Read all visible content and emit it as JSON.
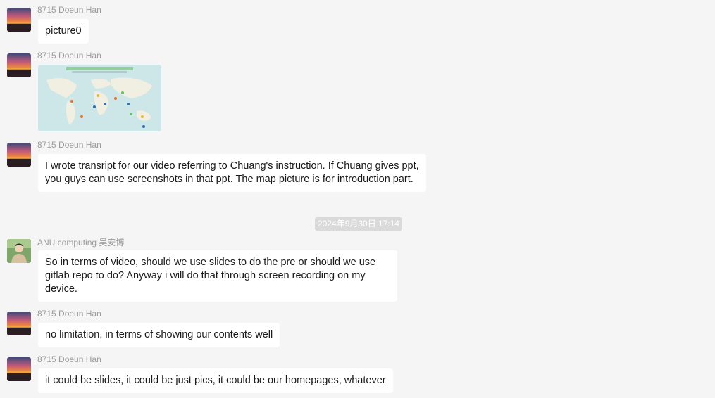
{
  "messages": [
    {
      "sender": "8715 Doeun Han",
      "avatar": "sunset-avatar",
      "text": "picture0"
    },
    {
      "sender": "8715 Doeun Han",
      "avatar": "sunset-avatar",
      "image": "world-map-thumbnail"
    },
    {
      "sender": "8715 Doeun Han",
      "avatar": "sunset-avatar",
      "text": "I wrote transript for our video referring to Chuang's instruction. If Chuang gives ppt, you guys can use screenshots in that ppt. The map picture is for introduction part."
    },
    {
      "sender": "ANU computing 吴安博",
      "avatar": "person-avatar",
      "text": "So in terms of video, should we use slides to do the pre or should we use gitlab repo to do? Anyway i will do that through screen recording on my device."
    },
    {
      "sender": "8715 Doeun Han",
      "avatar": "sunset-avatar",
      "text": "no limitation, in terms of showing our contents well"
    },
    {
      "sender": "8715 Doeun Han",
      "avatar": "sunset-avatar",
      "text": "it could be slides, it could be just pics, it could be our homepages, whatever"
    }
  ],
  "timestamp": "2024年9月30日 17:14",
  "colors": {
    "background": "#f5f5f5",
    "bubble": "#ffffff",
    "sender_text": "#9b9b9b",
    "timestamp_bg": "#dadada"
  }
}
